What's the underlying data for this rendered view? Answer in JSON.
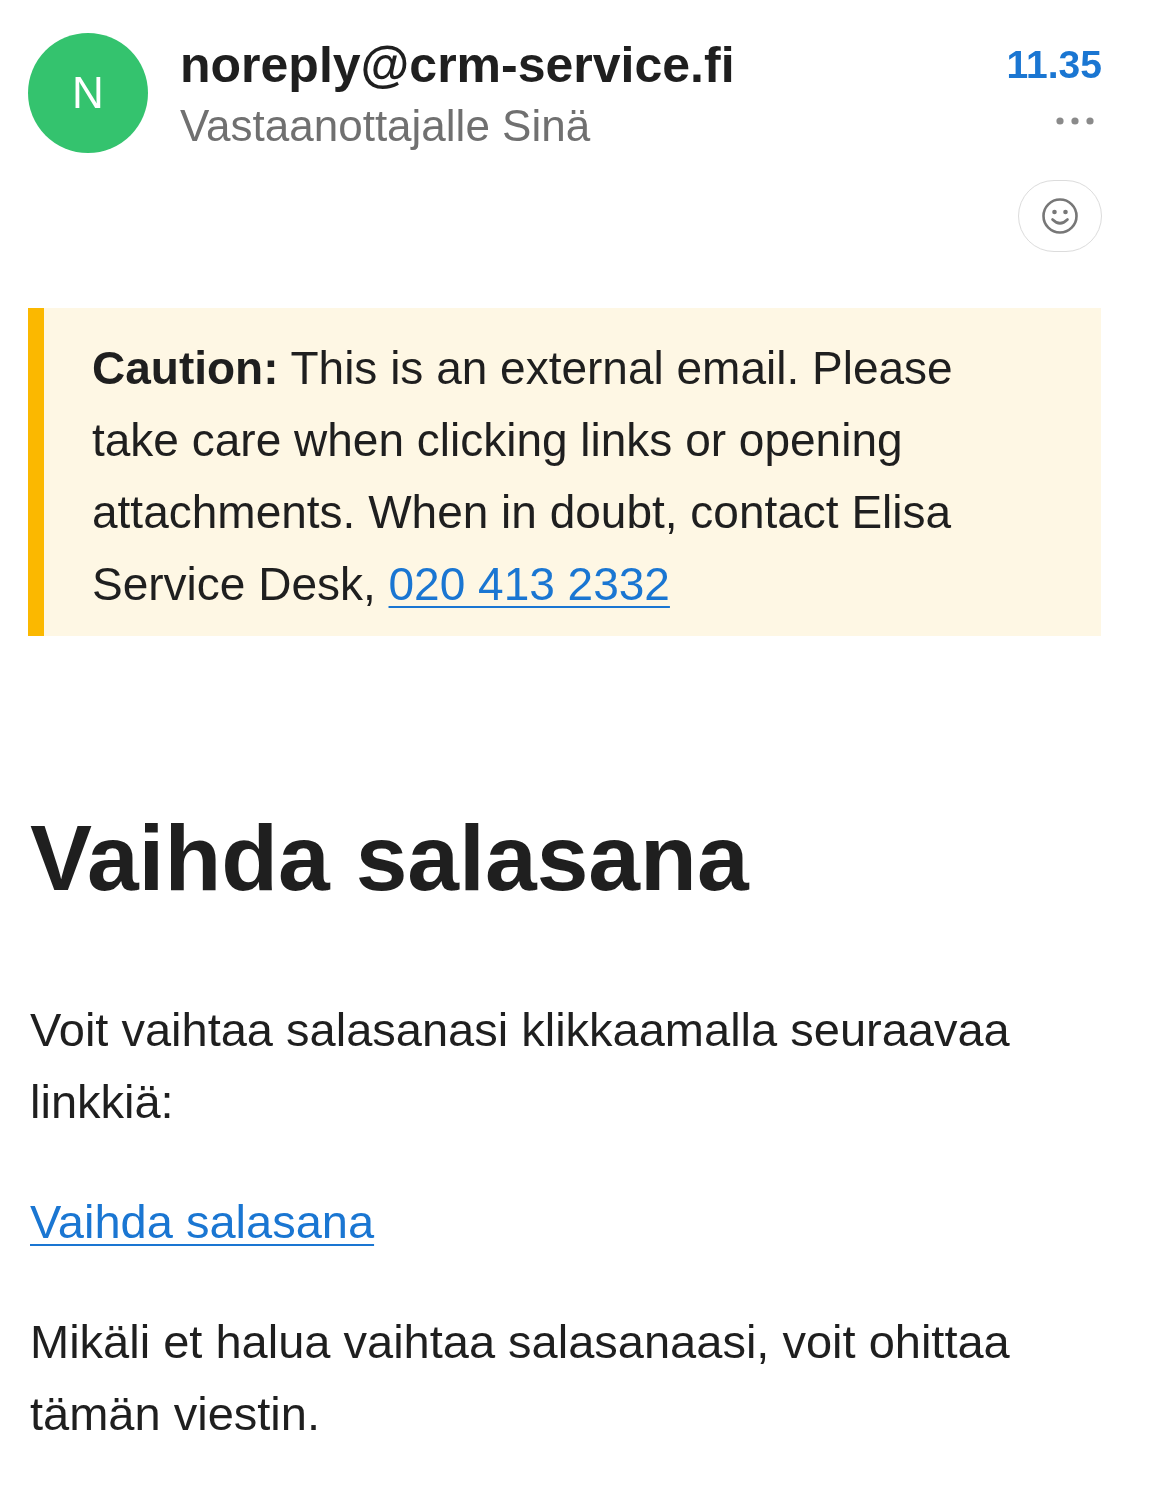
{
  "message_header": {
    "avatar_initial": "N",
    "sender": "noreply@crm-service.fi",
    "recipient": "Vastaanottajalle Sinä",
    "time": "11.35"
  },
  "warning_banner": {
    "text": "**Caution:** This is an external email. Please take care when clicking links or opening attachments. When in doubt, contact Elisa Service Desk,",
    "link": "020 413 2332"
  },
  "body": [
    {
      "kind": "heading",
      "text": "Vaihda salasana"
    },
    {
      "kind": "paragraph",
      "text": "Voit vaihtaa salasanasi klikkaamalla seuraavaa linkkiä:"
    },
    {
      "kind": "link",
      "text": "Vaihda salasana"
    },
    {
      "kind": "paragraph",
      "text": "Mikäli et halua vaihtaa salasanaasi, voit ohittaa tämän viestin."
    }
  ]
}
